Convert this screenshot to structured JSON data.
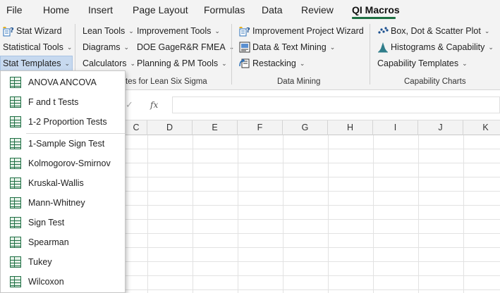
{
  "tabs": [
    "File",
    "Home",
    "Insert",
    "Page Layout",
    "Formulas",
    "Data",
    "Review",
    "QI Macros"
  ],
  "active_tab": "QI Macros",
  "ribbon": {
    "stat_wizard": "Stat Wizard",
    "statistical_tools": "Statistical Tools",
    "stat_templates": "Stat Templates",
    "lean_tools": "Lean Tools",
    "diagrams": "Diagrams",
    "calculators": "Calculators",
    "improvement_tools": "Improvement Tools",
    "doe_gage": "DOE GageR&R FMEA",
    "planning_pm": "Planning & PM Tools",
    "improvement_wizard": "Improvement Project Wizard",
    "data_text_mining": "Data & Text Mining",
    "restacking": "Restacking",
    "box_dot_scatter": "Box, Dot & Scatter Plot",
    "histograms_capability": "Histograms & Capability",
    "capability_templates": "Capability Templates",
    "group_lean_partial": "tes for Lean Six Sigma",
    "group_data_mining": "Data Mining",
    "group_capability_charts": "Capability Charts"
  },
  "formula_bar": {
    "fx": "fx",
    "value": ""
  },
  "columns": [
    "C",
    "D",
    "E",
    "F",
    "G",
    "H",
    "I",
    "J",
    "K"
  ],
  "menu": {
    "items": [
      "ANOVA ANCOVA",
      "F and t Tests",
      "1-2 Proportion Tests",
      "1-Sample Sign Test",
      "Kolmogorov-Smirnov",
      "Kruskal-Wallis",
      "Mann-Whitney",
      "Sign Test",
      "Spearman",
      "Tukey",
      "Wilcoxon"
    ]
  },
  "colors": {
    "accent": "#1d6f42",
    "pressed": "#c7d9ef",
    "ribbon_bg": "#f3f3f3"
  }
}
